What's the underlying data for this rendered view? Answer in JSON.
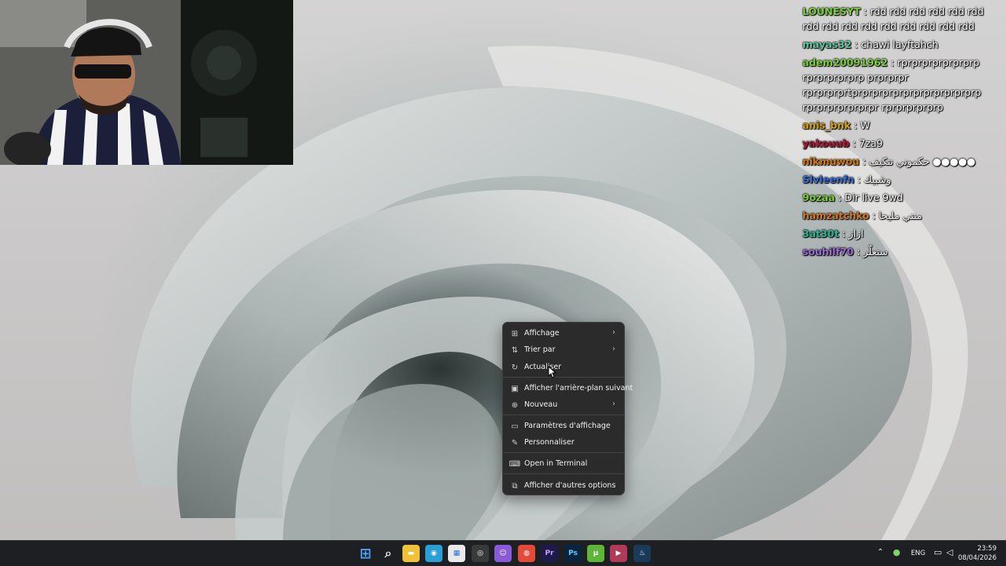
{
  "chat": {
    "messages": [
      {
        "user": "LOUNESYT",
        "color": "#7cd13a",
        "text": "rdd rdd rdd rdd rdd rdd rdd rdd rdd rdd rdd rdd rdd rdd rdd"
      },
      {
        "user": "mayas32",
        "color": "#5fc8a0",
        "text": "chawi layftahch"
      },
      {
        "user": "adem20091962",
        "color": "#7cd13a",
        "text": "rprprprprprprprp rprprprprprp prprprpr rprprprprtprprprprprprprprprprprprp rprprprprprprpr rprprprprprp"
      },
      {
        "user": "anis_bnk",
        "color": "#d6a418",
        "text": "W"
      },
      {
        "user": "yakouub",
        "color": "#b0183a",
        "text": "7za9"
      },
      {
        "user": "nikmuwou",
        "color": "#d27a10",
        "text": "حكموني نتكيف ●●●●●"
      },
      {
        "user": "Slvleenfn",
        "color": "#3a6fd8",
        "text": "وشبيك"
      },
      {
        "user": "9ozaa",
        "color": "#7cd13a",
        "text": "Dir live 9wd"
      },
      {
        "user": "hamzatchko",
        "color": "#d2782a",
        "text": "منتي مليحا"
      },
      {
        "user": "3at30t",
        "color": "#2ab89a",
        "text": "ازاز"
      },
      {
        "user": "souhilf70",
        "color": "#9a6ad8",
        "text": "ستعلّر"
      }
    ]
  },
  "context_menu": {
    "items": [
      {
        "label": "Affichage",
        "icon": "grid-icon",
        "submenu": true
      },
      {
        "label": "Trier par",
        "icon": "sort-icon",
        "submenu": true
      },
      {
        "label": "Actualiser",
        "icon": "refresh-icon",
        "submenu": false
      },
      {
        "label": "Afficher l'arrière-plan suivant",
        "icon": "next-background-icon",
        "submenu": false
      },
      {
        "label": "Nouveau",
        "icon": "new-icon",
        "submenu": true
      },
      {
        "label": "Paramètres d'affichage",
        "icon": "display-settings-icon",
        "submenu": false
      },
      {
        "label": "Personnaliser",
        "icon": "pen-icon",
        "submenu": false
      },
      {
        "label": "Open in Terminal",
        "icon": "terminal-icon",
        "submenu": false
      },
      {
        "label": "Afficher d'autres options",
        "icon": "more-options-icon",
        "submenu": false
      }
    ]
  },
  "taskbar": {
    "apps": [
      {
        "name": "start-button",
        "glyph": "",
        "color": "#3a8ee8"
      },
      {
        "name": "search-button",
        "glyph": "",
        "color": "transparent"
      },
      {
        "name": "file-explorer-icon",
        "glyph": "",
        "color": "#f2c13a"
      },
      {
        "name": "edge-icon",
        "glyph": "",
        "color": "#2a9fd6"
      },
      {
        "name": "store-icon",
        "glyph": "",
        "color": "#e9e9e9"
      },
      {
        "name": "obs-icon",
        "glyph": "",
        "color": "#3a3a3a"
      },
      {
        "name": "chat-app-icon",
        "glyph": "",
        "color": "#8a5ad8"
      },
      {
        "name": "chrome-icon",
        "glyph": "",
        "color": "#e24a3a"
      },
      {
        "name": "premiere-icon",
        "glyph": "Pr",
        "color": "#1e1a4a"
      },
      {
        "name": "photoshop-icon",
        "glyph": "Ps",
        "color": "#0a2440"
      },
      {
        "name": "utorrent-icon",
        "glyph": "",
        "color": "#5fb53a"
      },
      {
        "name": "media-player-icon",
        "glyph": "",
        "color": "#b03a5a"
      },
      {
        "name": "steam-icon",
        "glyph": "",
        "color": "#1a3a5a"
      }
    ],
    "tray": {
      "language": "ENG",
      "time": "23:59",
      "date": "08/04/2026"
    }
  }
}
